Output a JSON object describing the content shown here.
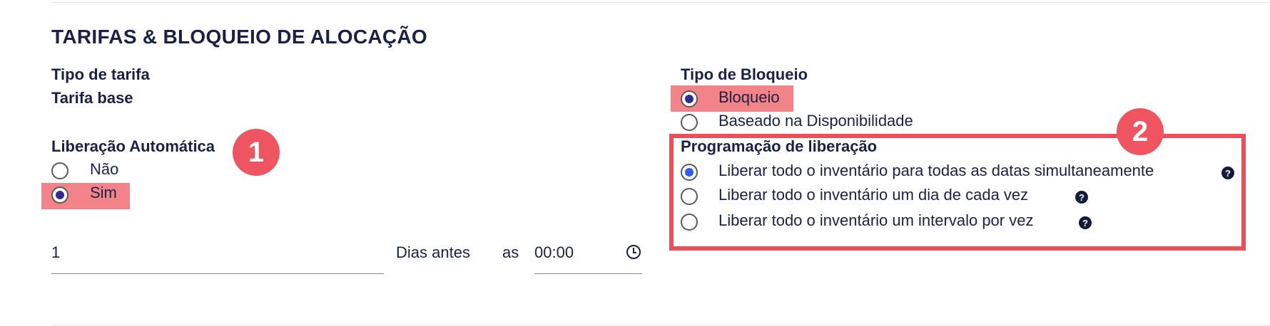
{
  "section": {
    "title": "TARIFAS & BLOQUEIO DE ALOCAÇÃO"
  },
  "tarifa": {
    "tipo_label": "Tipo de tarifa",
    "base_label": "Tarifa base"
  },
  "liberacao_automatica": {
    "label": "Liberação Automática",
    "options": [
      {
        "label": "Não",
        "selected": false
      },
      {
        "label": "Sim",
        "selected": true
      }
    ]
  },
  "days_input": {
    "value": "1",
    "suffix": "Dias antes",
    "at_label": "as",
    "time_value": "00:00"
  },
  "tipo_bloqueio": {
    "label": "Tipo de Bloqueio",
    "options": [
      {
        "label": "Bloqueio",
        "selected": true
      },
      {
        "label": "Baseado na Disponibilidade",
        "selected": false
      }
    ]
  },
  "programacao": {
    "label": "Programação de liberação",
    "options": [
      {
        "label": "Liberar todo o inventário para todas as datas simultaneamente",
        "selected": true
      },
      {
        "label": "Liberar todo o inventário um dia de cada vez",
        "selected": false
      },
      {
        "label": "Liberar todo o inventário um intervalo por vez",
        "selected": false
      }
    ]
  },
  "annotations": {
    "badge1": "1",
    "badge2": "2",
    "color": "#ea4f5a"
  },
  "colors": {
    "highlight": "#f28489",
    "primary_text": "#1a2145",
    "radio_checked_blue": "#2d5cf0"
  },
  "icons": {
    "help": "help-icon",
    "clock": "clock-icon"
  },
  "help_glyph": "?"
}
